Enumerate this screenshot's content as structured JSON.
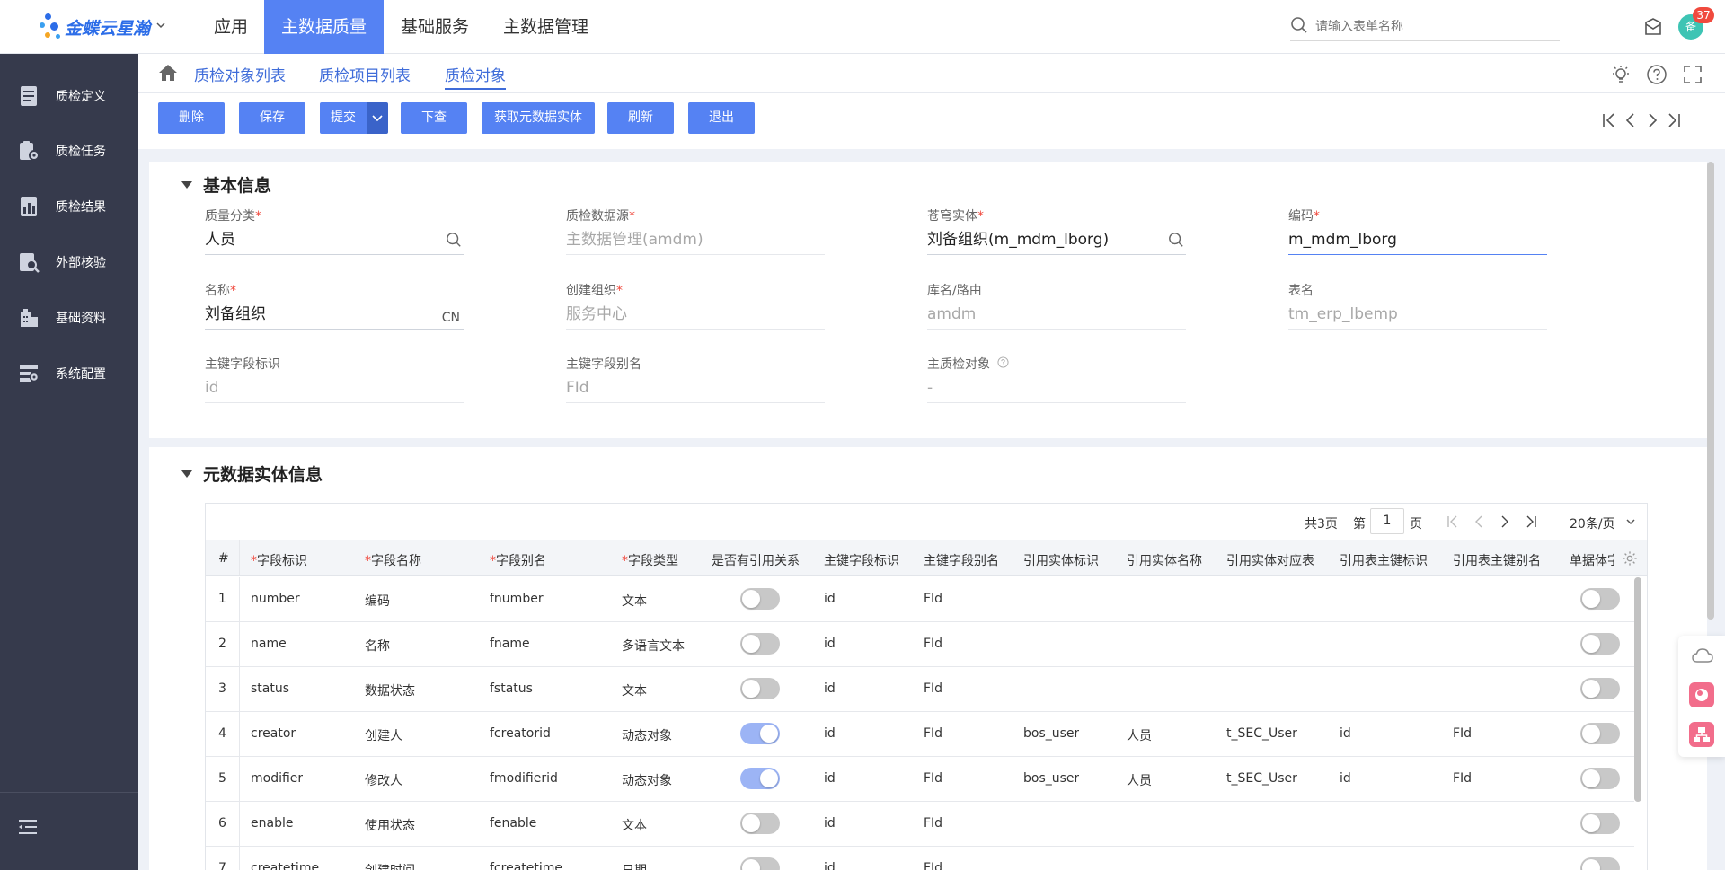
{
  "brand": {
    "name": "金蝶云星瀚"
  },
  "top_nav": [
    {
      "label": "应用"
    },
    {
      "label": "主数据质量"
    },
    {
      "label": "基础服务"
    },
    {
      "label": "主数据管理"
    }
  ],
  "search": {
    "placeholder": "请输入表单名称"
  },
  "user": {
    "avatar_text": "备",
    "badge_count": "37"
  },
  "sidebar": [
    {
      "label": "质检定义",
      "icon": "document-icon"
    },
    {
      "label": "质检任务",
      "icon": "task-gear-icon"
    },
    {
      "label": "质检结果",
      "icon": "result-chart-icon"
    },
    {
      "label": "外部核验",
      "icon": "external-check-icon"
    },
    {
      "label": "基础资料",
      "icon": "building-icon"
    },
    {
      "label": "系统配置",
      "icon": "system-config-icon"
    }
  ],
  "tabs": [
    {
      "label": "质检对象列表"
    },
    {
      "label": "质检项目列表"
    },
    {
      "label": "质检对象"
    }
  ],
  "toolbar": {
    "delete": "删除",
    "save": "保存",
    "submit": "提交",
    "check": "下查",
    "fetch_entity": "获取元数据实体",
    "refresh": "刷新",
    "exit": "退出"
  },
  "basic_info": {
    "title": "基本信息",
    "fields": [
      {
        "label": "质量分类",
        "required": "*",
        "value": "人员"
      },
      {
        "label": "质检数据源",
        "required": "*",
        "value": "主数据管理(amdm)"
      },
      {
        "label": "苍穹实体",
        "required": "*",
        "value": "刘备组织(m_mdm_lborg)"
      },
      {
        "label": "编码",
        "required": "*",
        "value": "m_mdm_lborg"
      },
      {
        "label": "名称",
        "required": "*",
        "value": "刘备组织",
        "suffix": "CN"
      },
      {
        "label": "创建组织",
        "required": "*",
        "value": "服务中心"
      },
      {
        "label": "库名/路由",
        "value": "amdm"
      },
      {
        "label": "表名",
        "value": "tm_erp_lbemp"
      },
      {
        "label": "主键字段标识",
        "value": "id"
      },
      {
        "label": "主键字段别名",
        "value": "FId"
      },
      {
        "label": "主质检对象",
        "value": "-"
      }
    ]
  },
  "meta_info": {
    "title": "元数据实体信息",
    "pager": {
      "total": "共3页",
      "page_prefix": "第",
      "page": "1",
      "page_suffix": "页",
      "page_size": "20条/页"
    },
    "columns": [
      {
        "label": "#"
      },
      {
        "label": "字段标识",
        "required": "*"
      },
      {
        "label": "字段名称",
        "required": "*"
      },
      {
        "label": "字段别名",
        "required": "*"
      },
      {
        "label": "字段类型",
        "required": "*"
      },
      {
        "label": "是否有引用关系"
      },
      {
        "label": "主键字段标识"
      },
      {
        "label": "主键字段别名"
      },
      {
        "label": "引用实体标识"
      },
      {
        "label": "引用实体名称"
      },
      {
        "label": "引用实体对应表"
      },
      {
        "label": "引用表主键标识"
      },
      {
        "label": "引用表主键别名"
      },
      {
        "label": "单据体字"
      }
    ],
    "rows": [
      {
        "idx": "1",
        "field_id": "number",
        "field_name": "编码",
        "alias": "fnumber",
        "type": "文本",
        "ref": false,
        "pk_id": "id",
        "pk_alias": "FId",
        "ref_entity": "",
        "ref_name": "",
        "ref_table": "",
        "ref_pk_id": "",
        "ref_pk_alias": "",
        "entry": false
      },
      {
        "idx": "2",
        "field_id": "name",
        "field_name": "名称",
        "alias": "fname",
        "type": "多语言文本",
        "ref": false,
        "pk_id": "id",
        "pk_alias": "FId",
        "ref_entity": "",
        "ref_name": "",
        "ref_table": "",
        "ref_pk_id": "",
        "ref_pk_alias": "",
        "entry": false
      },
      {
        "idx": "3",
        "field_id": "status",
        "field_name": "数据状态",
        "alias": "fstatus",
        "type": "文本",
        "ref": false,
        "pk_id": "id",
        "pk_alias": "FId",
        "ref_entity": "",
        "ref_name": "",
        "ref_table": "",
        "ref_pk_id": "",
        "ref_pk_alias": "",
        "entry": false
      },
      {
        "idx": "4",
        "field_id": "creator",
        "field_name": "创建人",
        "alias": "fcreatorid",
        "type": "动态对象",
        "ref": true,
        "pk_id": "id",
        "pk_alias": "FId",
        "ref_entity": "bos_user",
        "ref_name": "人员",
        "ref_table": "t_SEC_User",
        "ref_pk_id": "id",
        "ref_pk_alias": "FId",
        "entry": false
      },
      {
        "idx": "5",
        "field_id": "modifier",
        "field_name": "修改人",
        "alias": "fmodifierid",
        "type": "动态对象",
        "ref": true,
        "pk_id": "id",
        "pk_alias": "FId",
        "ref_entity": "bos_user",
        "ref_name": "人员",
        "ref_table": "t_SEC_User",
        "ref_pk_id": "id",
        "ref_pk_alias": "FId",
        "entry": false
      },
      {
        "idx": "6",
        "field_id": "enable",
        "field_name": "使用状态",
        "alias": "fenable",
        "type": "文本",
        "ref": false,
        "pk_id": "id",
        "pk_alias": "FId",
        "ref_entity": "",
        "ref_name": "",
        "ref_table": "",
        "ref_pk_id": "",
        "ref_pk_alias": "",
        "entry": false
      },
      {
        "idx": "7",
        "field_id": "createtime",
        "field_name": "创建时间",
        "alias": "fcreatetime",
        "type": "日期",
        "ref": false,
        "pk_id": "id",
        "pk_alias": "FId",
        "ref_entity": "",
        "ref_name": "",
        "ref_table": "",
        "ref_pk_id": "",
        "ref_pk_alias": "",
        "entry": false
      }
    ]
  },
  "colors": {
    "primary": "#5582f3",
    "sidebar_bg": "#363a4c",
    "link": "#3f6cd9",
    "required": "#f04a3e"
  }
}
